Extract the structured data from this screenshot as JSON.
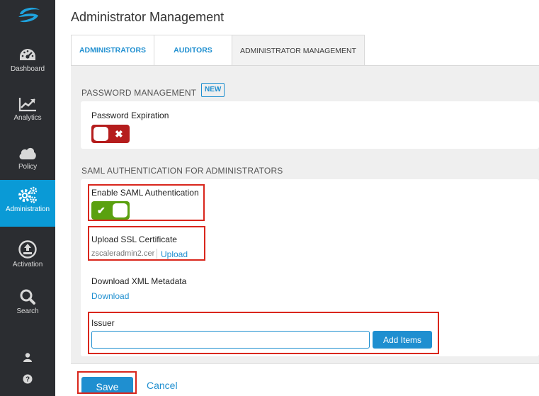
{
  "sidebar": {
    "items": [
      {
        "label": "Dashboard",
        "icon": "speedometer-icon"
      },
      {
        "label": "Analytics",
        "icon": "line-chart-icon"
      },
      {
        "label": "Policy",
        "icon": "cloud-icon"
      },
      {
        "label": "Administration",
        "icon": "gears-icon",
        "active": true
      },
      {
        "label": "Activation",
        "icon": "upload-circle-icon"
      },
      {
        "label": "Search",
        "icon": "search-icon"
      }
    ],
    "bottom_icons": [
      "user-icon",
      "help-icon"
    ]
  },
  "page": {
    "title": "Administrator Management"
  },
  "tabs": [
    {
      "label": "ADMINISTRATORS"
    },
    {
      "label": "AUDITORS"
    },
    {
      "label": "ADMINISTRATOR MANAGEMENT",
      "active": true
    }
  ],
  "password_section": {
    "heading": "PASSWORD MANAGEMENT",
    "badge": "NEW",
    "expiration_label": "Password Expiration",
    "expiration_enabled": false
  },
  "saml_section": {
    "heading": "SAML AUTHENTICATION FOR ADMINISTRATORS",
    "enable_label": "Enable SAML Authentication",
    "enable_enabled": true,
    "upload_label": "Upload SSL Certificate",
    "certificate_file": "zscaleradmin2.cer",
    "upload_link": "Upload",
    "metadata_label": "Download XML Metadata",
    "download_link": "Download",
    "issuer_label": "Issuer",
    "issuer_value": "",
    "add_items_button": "Add Items"
  },
  "footer": {
    "save_label": "Save",
    "cancel_label": "Cancel"
  },
  "colors": {
    "accent": "#1f8fd0",
    "sidebar_bg": "#2b2d31",
    "active_nav": "#0a9ad6",
    "toggle_off": "#b51d1d",
    "toggle_on": "#5aa10f",
    "highlight": "#d9261c"
  }
}
